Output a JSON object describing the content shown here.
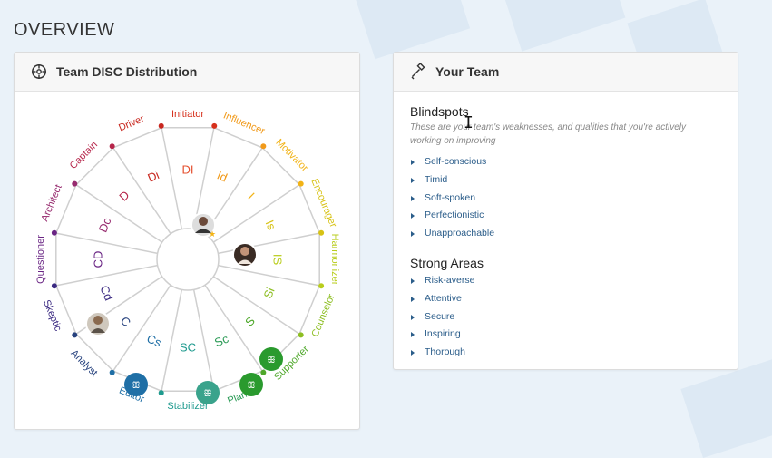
{
  "page": {
    "title": "OVERVIEW"
  },
  "disc_card": {
    "title": "Team DISC Distribution",
    "outer_labels": [
      {
        "text": "Initiator",
        "color": "#d6301c"
      },
      {
        "text": "Influencer",
        "color": "#f19a1a"
      },
      {
        "text": "Motivator",
        "color": "#f2b316"
      },
      {
        "text": "Encourager",
        "color": "#d7c214"
      },
      {
        "text": "Harmonizer",
        "color": "#b9cd1d"
      },
      {
        "text": "Counselor",
        "color": "#8dbe22"
      },
      {
        "text": "Supporter",
        "color": "#4fa82b"
      },
      {
        "text": "Planner",
        "color": "#2a9a55"
      },
      {
        "text": "Stabilizer",
        "color": "#1e9a8e"
      },
      {
        "text": "Editor",
        "color": "#1f6fa6"
      },
      {
        "text": "Analyst",
        "color": "#27427e"
      },
      {
        "text": "Skeptic",
        "color": "#3b2a82"
      },
      {
        "text": "Questioner",
        "color": "#6a2584"
      },
      {
        "text": "Architect",
        "color": "#972b6f"
      },
      {
        "text": "Captain",
        "color": "#b6254a"
      },
      {
        "text": "Driver",
        "color": "#c8271f"
      }
    ],
    "inner_labels": [
      {
        "text": "DI",
        "color": "#e5502f"
      },
      {
        "text": "Id",
        "color": "#f19a1a"
      },
      {
        "text": "I",
        "color": "#f2b316"
      },
      {
        "text": "Is",
        "color": "#d7c214"
      },
      {
        "text": "IS",
        "color": "#b9cd1d"
      },
      {
        "text": "Si",
        "color": "#8dbe22"
      },
      {
        "text": "S",
        "color": "#4fa82b"
      },
      {
        "text": "Sc",
        "color": "#2a9a55"
      },
      {
        "text": "SC",
        "color": "#1e9a8e"
      },
      {
        "text": "Cs",
        "color": "#1f6fa6"
      },
      {
        "text": "C",
        "color": "#27427e"
      },
      {
        "text": "Cd",
        "color": "#3b2a82"
      },
      {
        "text": "CD",
        "color": "#6a2584"
      },
      {
        "text": "Dc",
        "color": "#972b6f"
      },
      {
        "text": "D",
        "color": "#b6254a"
      },
      {
        "text": "Di",
        "color": "#c8271f"
      }
    ]
  },
  "team_card": {
    "title": "Your Team",
    "blindspots": {
      "heading": "Blindspots",
      "description": "These are your team's weaknesses, and qualities that you're actively working on improving",
      "items": [
        "Self-conscious",
        "Timid",
        "Soft-spoken",
        "Perfectionistic",
        "Unapproachable"
      ]
    },
    "strong_areas": {
      "heading": "Strong Areas",
      "items": [
        "Risk-averse",
        "Attentive",
        "Secure",
        "Inspiring",
        "Thorough"
      ]
    }
  }
}
